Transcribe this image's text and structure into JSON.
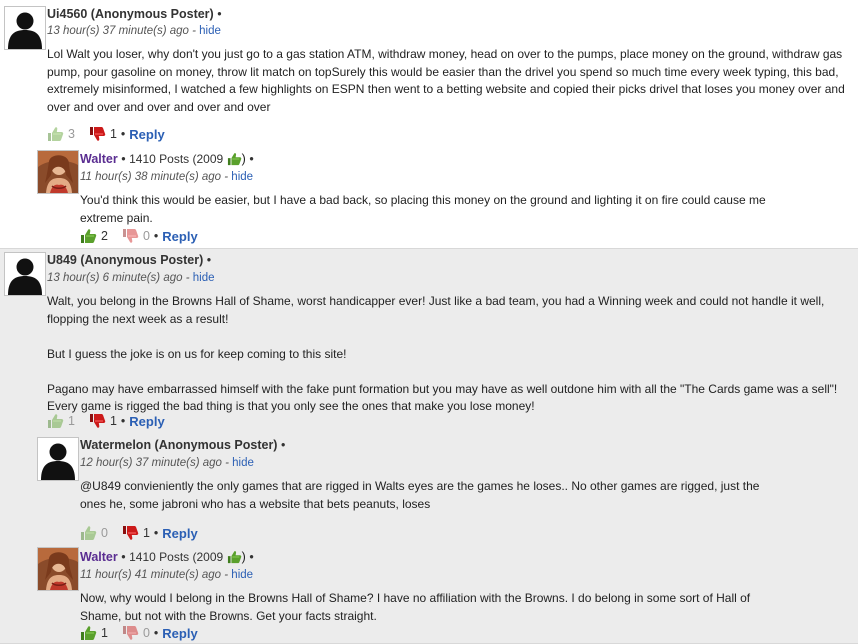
{
  "comments": [
    {
      "author": "Ui4560 (Anonymous Poster)",
      "time": "13 hour(s) 37 minute(s) ago",
      "hide": "hide",
      "body": [
        "Lol Walt you loser, why don't you just go to a gas station ATM, withdraw money, head on over to the pumps, place money on the ground, withdraw gas pump, pour gasoline on money, throw lit match on topSurely this would be easier than the drivel you spend so much time every week typing, this bad, extremely misinformed, I watched a few highlights on ESPN then went to a betting website and copied their picks drivel that loses you money over and over and over and over and over and over"
      ],
      "up": "3",
      "down": "1",
      "reply": "Reply"
    },
    {
      "author": "Walter",
      "posts": "1410 Posts (2009",
      "time": "11 hour(s) 38 minute(s) ago",
      "hide": "hide",
      "body": [
        "You'd think this would be easier, but I have a bad back, so placing this money on the ground and lighting it on fire could cause me extreme pain."
      ],
      "up": "2",
      "down": "0",
      "reply": "Reply"
    },
    {
      "author": "U849 (Anonymous Poster)",
      "time": "13 hour(s) 6 minute(s) ago",
      "hide": "hide",
      "body": [
        "Walt, you belong in the Browns Hall of Shame, worst handicapper ever! Just like a bad team, you had a Winning week and could not handle it well, flopping the next week as a result!",
        "But I guess the joke is on us for keep coming to this site!",
        "Pagano may have embarrassed himself with the fake punt formation but you may have as well outdone him with all the \"The Cards game was a sell\"! Every game is rigged the bad thing is that you only see the ones that make you lose money!"
      ],
      "up": "1",
      "down": "1",
      "reply": "Reply"
    },
    {
      "author": "Watermelon (Anonymous Poster)",
      "time": "12 hour(s) 37 minute(s) ago",
      "hide": "hide",
      "body": [
        "@U849 convieniently the only games that are rigged in Walts eyes are the games he loses.. No other games are rigged, just the ones he, some jabroni who has a website that bets peanuts, loses"
      ],
      "up": "0",
      "down": "1",
      "reply": "Reply"
    },
    {
      "author": "Walter",
      "posts": "1410 Posts (2009",
      "time": "11 hour(s) 41 minute(s) ago",
      "hide": "hide",
      "body": [
        "Now, why would I belong in the Browns Hall of Shame? I have no affiliation with the Browns. I do belong in some sort of Hall of Shame, but not with the Browns. Get your facts straight."
      ],
      "up": "1",
      "down": "0",
      "reply": "Reply"
    }
  ],
  "separator": "•",
  "colors": {
    "link": "#2b5fb4",
    "walter_name": "#5a2d91",
    "thumb_up": "#5aa02c",
    "thumb_down": "#cc1a1a",
    "thread_bg_alt": "#ececec"
  },
  "icons": {
    "anon_avatar": "silhouette-avatar",
    "walter_avatar": "photo-avatar",
    "up": "thumbs-up-icon",
    "down": "thumbs-down-icon"
  }
}
